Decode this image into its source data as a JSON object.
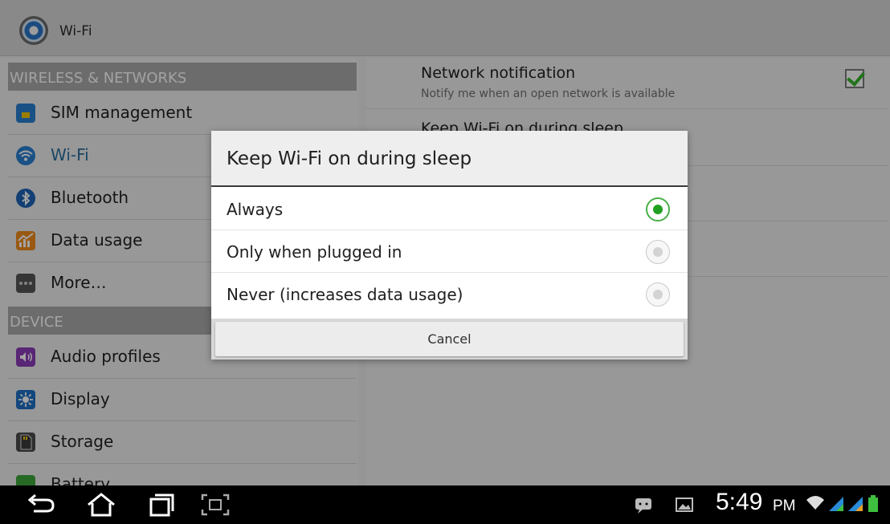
{
  "action_bar": {
    "title": "Wi-Fi",
    "icon": "settings-gear-icon"
  },
  "left_pane": {
    "sections": [
      {
        "header": "WIRELESS & NETWORKS",
        "items": [
          {
            "label": "SIM management",
            "icon": "sim-card-icon",
            "selected": false
          },
          {
            "label": "Wi-Fi",
            "icon": "wifi-icon",
            "selected": true
          },
          {
            "label": "Bluetooth",
            "icon": "bluetooth-icon",
            "selected": false
          },
          {
            "label": "Data usage",
            "icon": "data-usage-icon",
            "selected": false
          },
          {
            "label": "More…",
            "icon": "more-icon",
            "selected": false
          }
        ]
      },
      {
        "header": "DEVICE",
        "items": [
          {
            "label": "Audio profiles",
            "icon": "audio-profiles-icon",
            "selected": false
          },
          {
            "label": "Display",
            "icon": "display-icon",
            "selected": false
          },
          {
            "label": "Storage",
            "icon": "storage-icon",
            "selected": false
          },
          {
            "label": "Battery",
            "icon": "battery-icon",
            "selected": false
          }
        ]
      }
    ]
  },
  "right_pane": {
    "network_notification": {
      "title": "Network notification",
      "summary": "Notify me when an open network is available",
      "checked": true
    },
    "keep_wifi_on": {
      "title": "Keep Wi-Fi on during sleep"
    }
  },
  "dialog": {
    "title": "Keep Wi-Fi on during sleep",
    "options": [
      {
        "label": "Always",
        "selected": true
      },
      {
        "label": "Only when plugged in",
        "selected": false
      },
      {
        "label": "Never (increases data usage)",
        "selected": false
      }
    ],
    "cancel_label": "Cancel"
  },
  "system_bar": {
    "nav_icons": [
      "back-icon",
      "home-icon",
      "recent-apps-icon",
      "screenshot-icon"
    ],
    "status_icons": [
      "notification-icon",
      "gallery-icon",
      "wifi-signal-icon",
      "signal-strength-icon",
      "battery-icon"
    ],
    "time": "5:49",
    "ampm": "PM"
  },
  "colors": {
    "accent": "#20a020",
    "selected_text": "#2b6e9e",
    "section_header": "#a9a9a9"
  }
}
